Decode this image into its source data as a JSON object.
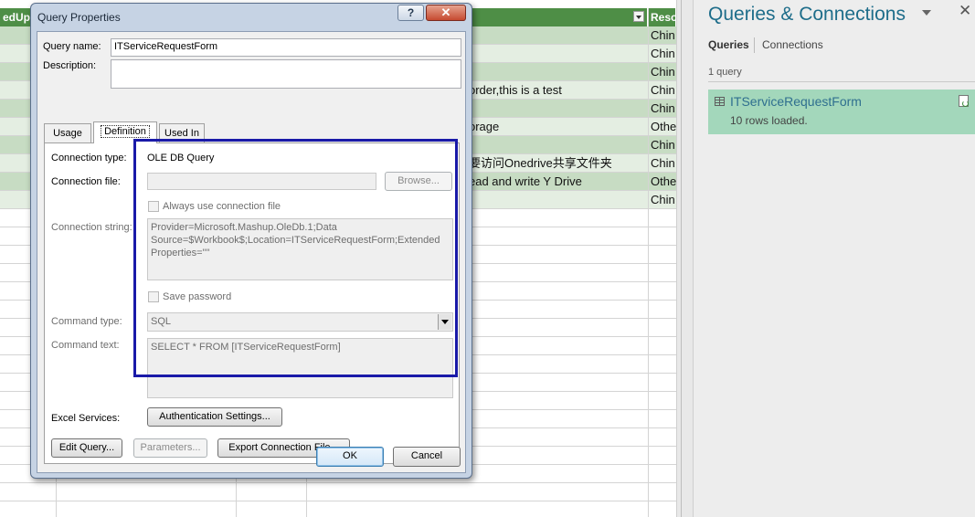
{
  "sheet": {
    "headers": [
      "edUp",
      "Reso"
    ],
    "rows": [
      {
        "text": "",
        "res": "Chin"
      },
      {
        "text": "",
        "res": "Chin"
      },
      {
        "text": "",
        "res": "Chin"
      },
      {
        "text": "order,this is a test",
        "res": "Chin"
      },
      {
        "text": "",
        "res": "Chin"
      },
      {
        "text": "orage",
        "res": "Othe"
      },
      {
        "text": "",
        "res": "Chin"
      },
      {
        "text": "要访问Onedrive共享文件夹",
        "res": "Chin"
      },
      {
        "text": "ead and write Y Drive",
        "res": "Othe"
      },
      {
        "text": "",
        "res": "Chin"
      }
    ]
  },
  "pane": {
    "title": "Queries & Connections",
    "tabs": [
      "Queries",
      "Connections"
    ],
    "count_label": "1 query",
    "query_name": "ITServiceRequestForm",
    "query_status": "10 rows loaded."
  },
  "dialog": {
    "title": "Query Properties",
    "help_label": "?",
    "close_label": "✕",
    "query_name_label": "Query name:",
    "query_name_value": "ITServiceRequestForm",
    "description_label": "Description:",
    "description_value": "",
    "tabs": [
      "Usage",
      "Definition",
      "Used In"
    ],
    "connection_type_label": "Connection type:",
    "connection_type_value": "OLE DB Query",
    "connection_file_label": "Connection file:",
    "connection_file_value": "",
    "browse_label": "Browse...",
    "always_use_label": "Always use connection file",
    "connection_string_label": "Connection string:",
    "connection_string_value": "Provider=Microsoft.Mashup.OleDb.1;Data Source=$Workbook$;Location=ITServiceRequestForm;Extended Properties=\"\"",
    "save_password_label": "Save password",
    "command_type_label": "Command type:",
    "command_type_value": "SQL",
    "command_text_label": "Command text:",
    "command_text_value": "SELECT * FROM [ITServiceRequestForm]",
    "excel_services_label": "Excel Services:",
    "auth_settings_label": "Authentication Settings...",
    "edit_query_label": "Edit Query...",
    "parameters_label": "Parameters...",
    "export_label": "Export Connection File...",
    "ok_label": "OK",
    "cancel_label": "Cancel"
  }
}
